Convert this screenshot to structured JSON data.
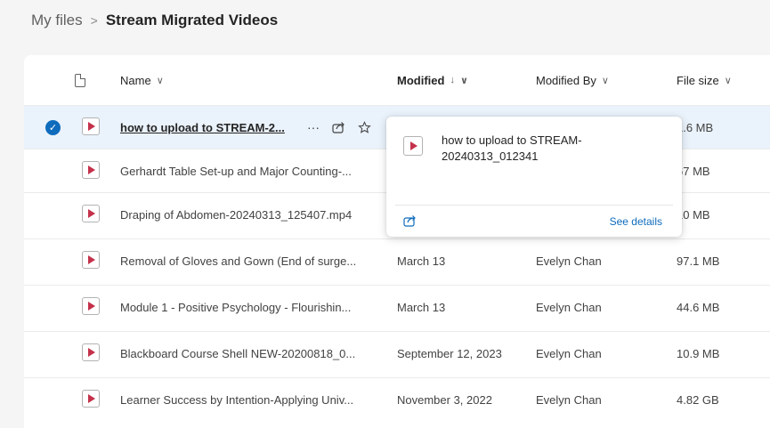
{
  "breadcrumb": {
    "root": "My files",
    "separator": ">",
    "current": "Stream Migrated Videos"
  },
  "columns": {
    "name": "Name",
    "modified": "Modified",
    "modified_sort": "↓",
    "modified_by": "Modified By",
    "file_size": "File size",
    "chevron": "∨"
  },
  "rows": [
    {
      "name": "how to upload to STREAM-2...",
      "modified": "",
      "modified_by": "",
      "size": "1.6 MB",
      "selected": true
    },
    {
      "name": "Gerhardt Table Set-up and Major Counting-...",
      "modified": "",
      "modified_by": "",
      "size": "67 MB"
    },
    {
      "name": "Draping of Abdomen-20240313_125407.mp4",
      "modified": "",
      "modified_by": "",
      "size": "10 MB"
    },
    {
      "name": "Removal of Gloves and Gown (End of surge...",
      "modified": "March 13",
      "modified_by": "Evelyn Chan",
      "size": "97.1 MB"
    },
    {
      "name": "Module 1 - Positive Psychology - Flourishin...",
      "modified": "March 13",
      "modified_by": "Evelyn Chan",
      "size": "44.6 MB"
    },
    {
      "name": "Blackboard Course Shell NEW-20200818_0...",
      "modified": "September 12, 2023",
      "modified_by": "Evelyn Chan",
      "size": "10.9 MB"
    },
    {
      "name": "Learner Success by Intention-Applying Univ...",
      "modified": "November 3, 2022",
      "modified_by": "Evelyn Chan",
      "size": "4.82 GB"
    }
  ],
  "row_actions": {
    "more": "···"
  },
  "popup": {
    "title": "how to upload to STREAM-20240313_012341",
    "see_details": "See details"
  },
  "colors": {
    "accent": "#0f6cbd",
    "video_red": "#c4314b",
    "selected_row": "#eaf2fb"
  }
}
